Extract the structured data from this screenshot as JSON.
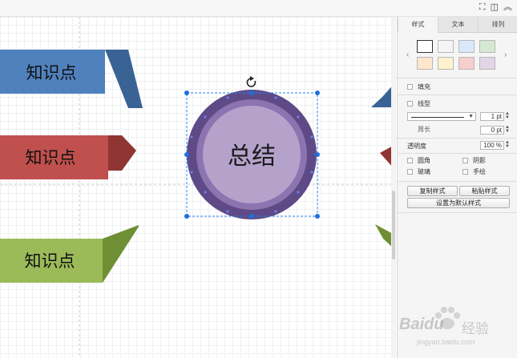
{
  "toolbar": {
    "icons": [
      "fit-icon",
      "panel-toggle-icon",
      "collapse-up-icon"
    ]
  },
  "canvas": {
    "cards": [
      {
        "label": "知识点",
        "color": "#4f81bd",
        "shade": "#3a6395"
      },
      {
        "label": "知识点",
        "color": "#c0504d",
        "shade": "#8f3532"
      },
      {
        "label": "知识点",
        "color": "#9bbb59",
        "shade": "#6f8f34"
      }
    ],
    "center": {
      "label": "总结",
      "outer": "#5e4a86",
      "inner": "#b4a2cb"
    }
  },
  "panel": {
    "tabs": [
      "样式",
      "文本",
      "排列"
    ],
    "active_tab": "样式",
    "swatches": [
      "#ffffff",
      "#f5f5f5",
      "#dae8fc",
      "#d5e8d4",
      "#ffe6cc",
      "#fff2cc",
      "#f8cecc",
      "#e1d5e7"
    ],
    "fill_label": "填充",
    "line_label": "线型",
    "line_width": "1 pt",
    "perimeter_label": "周长",
    "perimeter_value": "0 pt",
    "opacity_label": "透明度",
    "opacity_value": "100 %",
    "rounded_label": "圆角",
    "shadow_label": "阴影",
    "glass_label": "玻璃",
    "sketch_label": "手绘",
    "copy_style": "复制样式",
    "paste_style": "粘贴样式",
    "set_default": "设置为默认样式"
  },
  "watermark": {
    "brand": "Baidu",
    "suffix": "经验",
    "url": "jingyan.baidu.com"
  }
}
